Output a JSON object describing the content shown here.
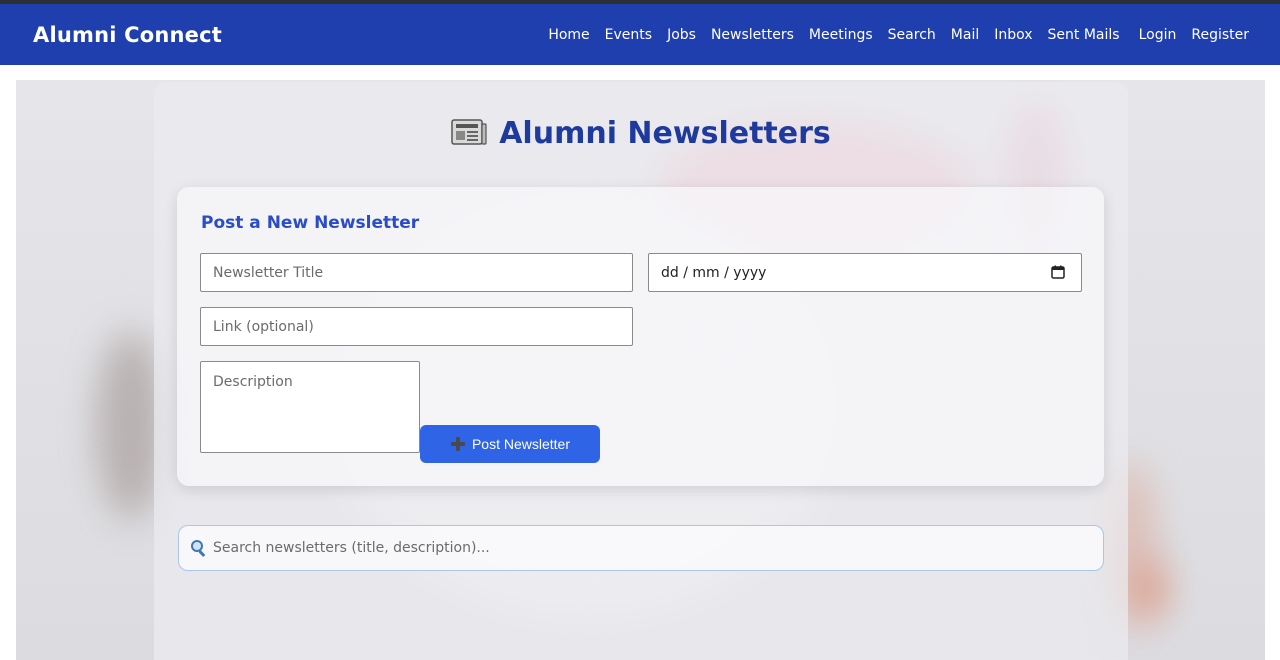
{
  "app": {
    "brand": "Alumni Connect"
  },
  "nav": {
    "items": [
      "Home",
      "Events",
      "Jobs",
      "Newsletters",
      "Meetings",
      "Search",
      "Mail",
      "Inbox",
      "Sent Mails",
      "Login",
      "Register"
    ]
  },
  "page": {
    "title": "Alumni Newsletters",
    "title_icon": "newspaper-icon"
  },
  "form": {
    "heading": "Post a New Newsletter",
    "title_placeholder": "Newsletter Title",
    "date_placeholder": "dd / mm / yyyy",
    "link_placeholder": "Link (optional)",
    "description_placeholder": "Description",
    "submit_label": "Post Newsletter",
    "submit_icon": "plus-icon"
  },
  "search": {
    "placeholder": "Search newsletters (title, description)...",
    "icon": "magnifier-icon"
  },
  "colors": {
    "navbar": "#1f3fae",
    "title": "#1e3a9c",
    "heading": "#2a4cc8",
    "button": "#2f64e6"
  }
}
